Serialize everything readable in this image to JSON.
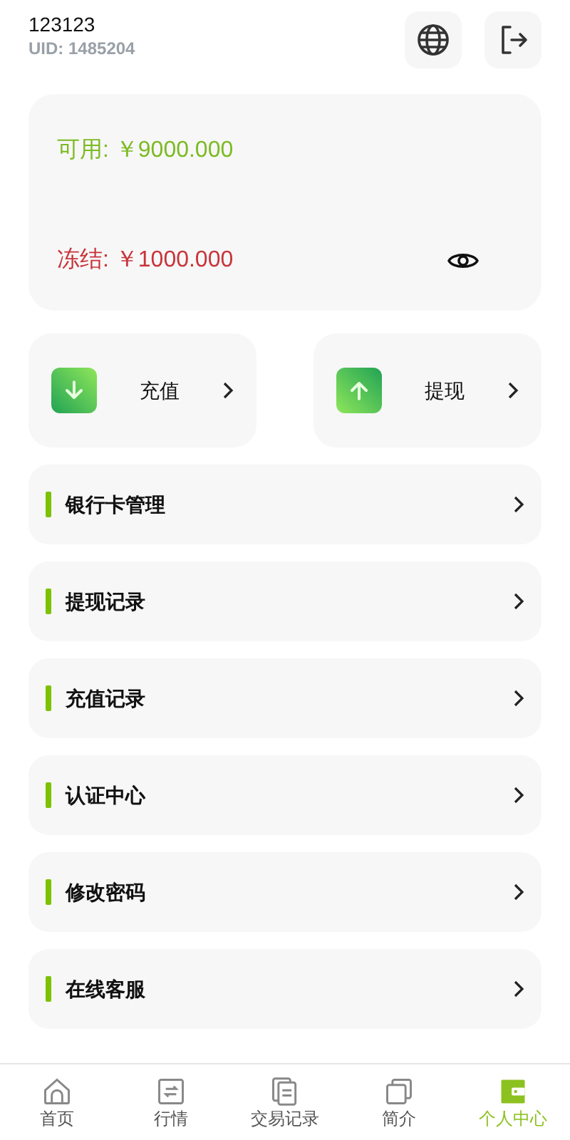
{
  "user": {
    "name": "123123",
    "uid": "UID: 1485204"
  },
  "balance": {
    "available": "可用: ￥9000.000",
    "frozen": "冻结: ￥1000.000"
  },
  "actions": [
    {
      "kind": "deposit",
      "label": "充值"
    },
    {
      "kind": "withdraw",
      "label": "提现"
    }
  ],
  "menu": [
    {
      "label": "银行卡管理"
    },
    {
      "label": "提现记录"
    },
    {
      "label": "充值记录"
    },
    {
      "label": "认证中心"
    },
    {
      "label": "修改密码"
    },
    {
      "label": "在线客服"
    }
  ],
  "tabbar": [
    {
      "kind": "home",
      "label": "首页",
      "selected": false
    },
    {
      "kind": "market",
      "label": "行情",
      "selected": false
    },
    {
      "kind": "records",
      "label": "交易记录",
      "selected": false
    },
    {
      "kind": "about",
      "label": "简介",
      "selected": false
    },
    {
      "kind": "profile",
      "label": "个人中心",
      "selected": true
    }
  ]
}
